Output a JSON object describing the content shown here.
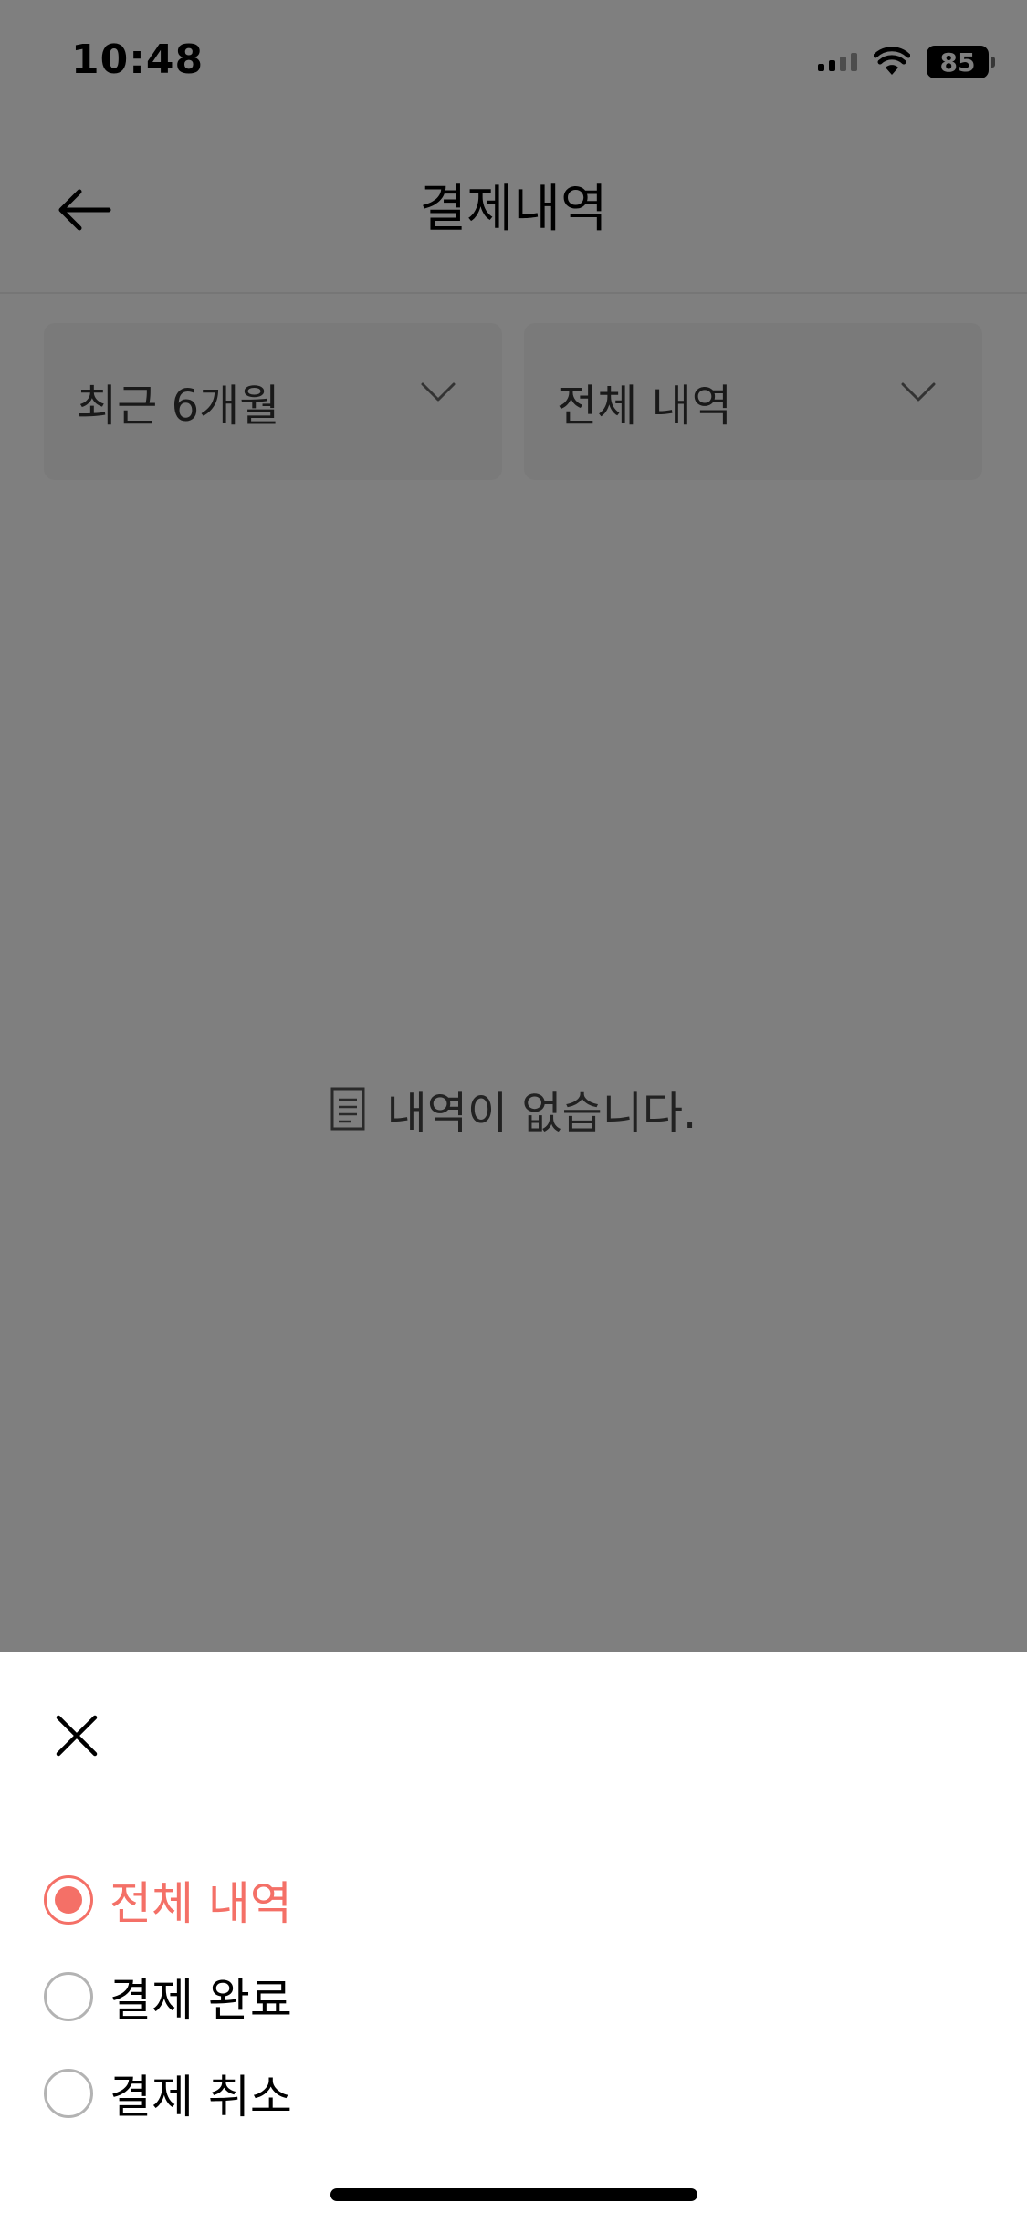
{
  "status_bar": {
    "time": "10:48",
    "battery": "85",
    "icons": [
      "cellular-signal-icon",
      "wifi-icon",
      "battery-icon"
    ]
  },
  "header": {
    "title": "결제내역",
    "back_icon": "arrow-left-icon"
  },
  "filters": {
    "period": "최근 6개월",
    "type": "전체 내역",
    "dropdown_icon": "chevron-down-icon"
  },
  "empty_state": {
    "icon": "document-icon",
    "message": "내역이 없습니다."
  },
  "sheet": {
    "close_icon": "close-icon",
    "options": [
      {
        "label": "전체 내역",
        "selected": true
      },
      {
        "label": "결제 완료",
        "selected": false
      },
      {
        "label": "결제 취소",
        "selected": false
      }
    ]
  },
  "colors": {
    "accent": "#f47067",
    "overlay": "rgba(0,0,0,0.5)",
    "dropdown_bg": "#f4f4f4"
  }
}
